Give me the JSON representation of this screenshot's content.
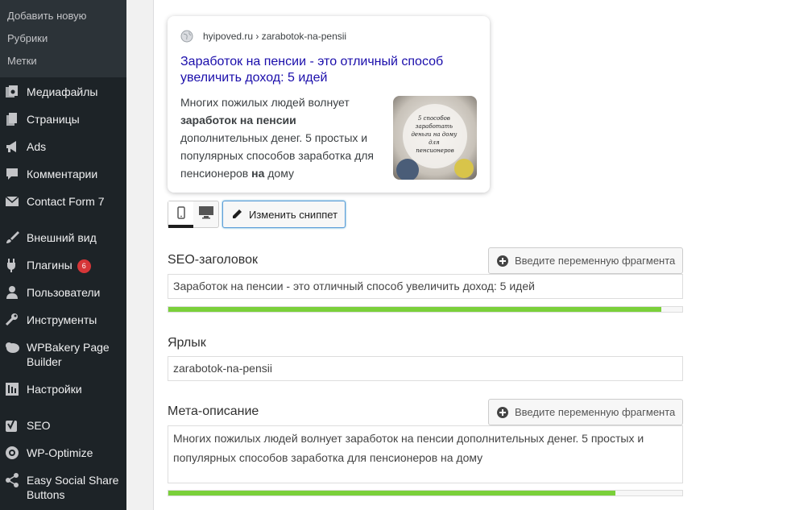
{
  "sidebar": {
    "submenu": [
      "Добавить новую",
      "Рубрики",
      "Метки"
    ],
    "items": [
      {
        "label": "Медиафайлы",
        "icon": "media-icon"
      },
      {
        "label": "Страницы",
        "icon": "pages-icon"
      },
      {
        "label": "Ads",
        "icon": "megaphone-icon"
      },
      {
        "label": "Комментарии",
        "icon": "comments-icon"
      },
      {
        "label": "Contact Form 7",
        "icon": "mail-icon"
      },
      {
        "label": "Внешний вид",
        "icon": "brush-icon"
      },
      {
        "label": "Плагины",
        "icon": "plugins-icon",
        "badge": "6"
      },
      {
        "label": "Пользователи",
        "icon": "users-icon"
      },
      {
        "label": "Инструменты",
        "icon": "wrench-icon"
      },
      {
        "label": "WPBakery Page Builder",
        "icon": "wpbakery-icon"
      },
      {
        "label": "Настройки",
        "icon": "settings-icon"
      },
      {
        "label": "SEO",
        "icon": "yoast-icon"
      },
      {
        "label": "WP-Optimize",
        "icon": "optimize-icon"
      },
      {
        "label": "Easy Social Share Buttons",
        "icon": "share-icon"
      }
    ]
  },
  "snippet": {
    "breadcrumb": "hyipoved.ru › zarabotok-na-pensii",
    "title": "Заработок на пенсии - это отличный способ увеличить доход: 5 идей",
    "desc_part1": "Многих пожилых людей волнует ",
    "desc_bold1": "заработок на пенсии",
    "desc_part2": " дополнительных денег. 5 простых и популярных способов заработка для пенсионеров ",
    "desc_bold2": "на",
    "desc_part3": " дому",
    "thumb_text": "5 способов заработать деньги на дому для пенсионеров"
  },
  "controls": {
    "edit_snippet": "Изменить сниппет",
    "mobile_mode": "mobile-icon",
    "desktop_mode": "desktop-icon"
  },
  "seo_title": {
    "label": "SEO-заголовок",
    "var_button": "Введите переменную фрагмента",
    "value": "Заработок на пенсии - это отличный способ увеличить доход: 5 идей",
    "progress": 0.96
  },
  "slug": {
    "label": "Ярлык",
    "value": "zarabotok-na-pensii"
  },
  "meta_desc": {
    "label": "Мета-описание",
    "var_button": "Введите переменную фрагмента",
    "value": "Многих пожилых людей волнует заработок на пенсии дополнительных денег. 5 простых и популярных способов заработка для пенсионеров на дому",
    "progress": 0.87
  },
  "colors": {
    "sidebar_bg": "#1d2327",
    "submenu_bg": "#2c3338",
    "link_blue": "#1a0dab",
    "progress_green": "#7ad03a",
    "badge_red": "#d63638"
  }
}
